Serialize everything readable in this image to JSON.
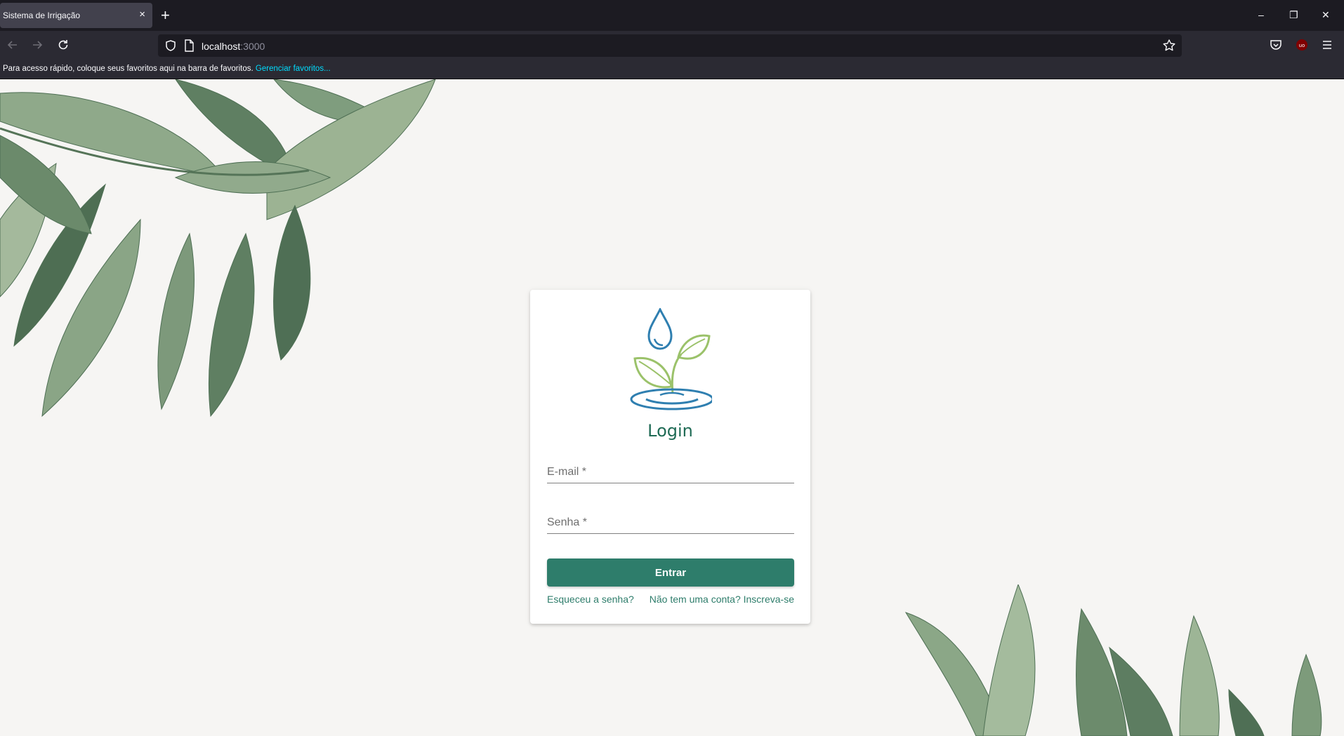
{
  "browser": {
    "tab_title": "Sistema de Irrigação",
    "tab_close": "×",
    "new_tab": "+",
    "url_host": "localhost",
    "url_port": ":3000",
    "bookmarks_text": "Para acesso rápido, coloque seus favoritos aqui na barra de favoritos.",
    "bookmarks_link": "Gerenciar favoritos...",
    "window_controls": {
      "minimize": "–",
      "restore": "❐",
      "close": "✕"
    },
    "icons": [
      "back-arrow-icon",
      "forward-arrow-icon",
      "reload-icon",
      "shield-icon",
      "page-icon",
      "star-icon",
      "pocket-icon",
      "ublock-icon",
      "menu-icon"
    ]
  },
  "login": {
    "title": "Login",
    "email_label": "E-mail *",
    "password_label": "Senha *",
    "submit_label": "Entrar",
    "forgot_link": "Esqueceu a senha?",
    "signup_link": "Não tem uma conta? Inscreva-se",
    "logo_icon": "water-drop-sprout-icon"
  },
  "colors": {
    "accent": "#2e7d6b",
    "title": "#1f6b55",
    "background": "#f6f5f3",
    "logo_blue": "#2f7fb0",
    "logo_green": "#9bc26a"
  }
}
